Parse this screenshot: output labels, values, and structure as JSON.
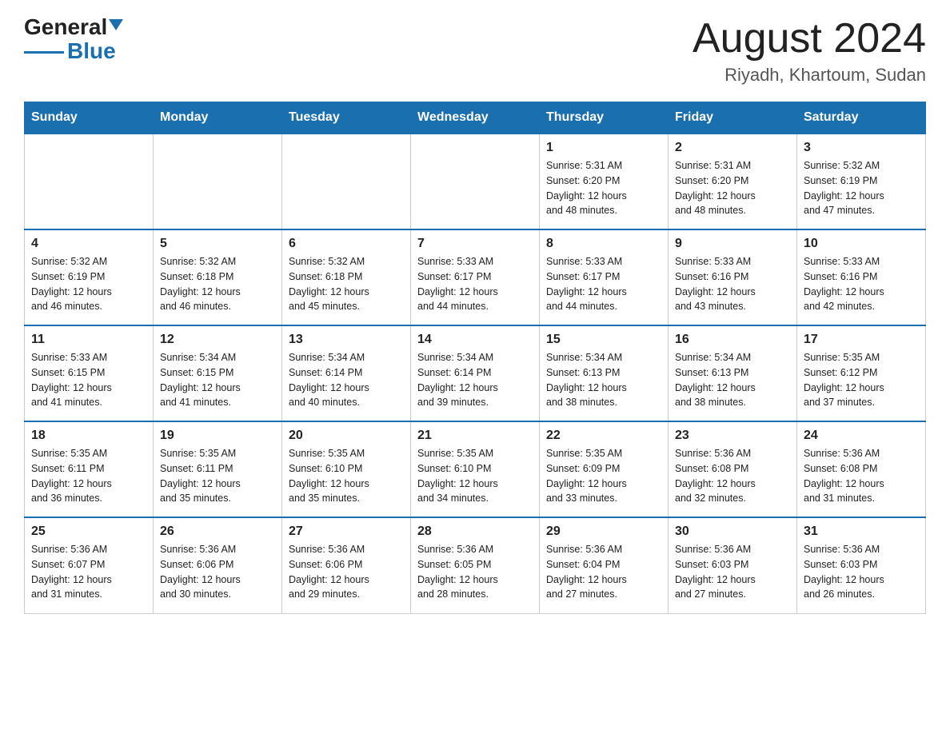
{
  "logo": {
    "general": "General",
    "blue": "Blue"
  },
  "header": {
    "month": "August 2024",
    "location": "Riyadh, Khartoum, Sudan"
  },
  "days_of_week": [
    "Sunday",
    "Monday",
    "Tuesday",
    "Wednesday",
    "Thursday",
    "Friday",
    "Saturday"
  ],
  "weeks": [
    [
      {
        "day": "",
        "info": ""
      },
      {
        "day": "",
        "info": ""
      },
      {
        "day": "",
        "info": ""
      },
      {
        "day": "",
        "info": ""
      },
      {
        "day": "1",
        "info": "Sunrise: 5:31 AM\nSunset: 6:20 PM\nDaylight: 12 hours\nand 48 minutes."
      },
      {
        "day": "2",
        "info": "Sunrise: 5:31 AM\nSunset: 6:20 PM\nDaylight: 12 hours\nand 48 minutes."
      },
      {
        "day": "3",
        "info": "Sunrise: 5:32 AM\nSunset: 6:19 PM\nDaylight: 12 hours\nand 47 minutes."
      }
    ],
    [
      {
        "day": "4",
        "info": "Sunrise: 5:32 AM\nSunset: 6:19 PM\nDaylight: 12 hours\nand 46 minutes."
      },
      {
        "day": "5",
        "info": "Sunrise: 5:32 AM\nSunset: 6:18 PM\nDaylight: 12 hours\nand 46 minutes."
      },
      {
        "day": "6",
        "info": "Sunrise: 5:32 AM\nSunset: 6:18 PM\nDaylight: 12 hours\nand 45 minutes."
      },
      {
        "day": "7",
        "info": "Sunrise: 5:33 AM\nSunset: 6:17 PM\nDaylight: 12 hours\nand 44 minutes."
      },
      {
        "day": "8",
        "info": "Sunrise: 5:33 AM\nSunset: 6:17 PM\nDaylight: 12 hours\nand 44 minutes."
      },
      {
        "day": "9",
        "info": "Sunrise: 5:33 AM\nSunset: 6:16 PM\nDaylight: 12 hours\nand 43 minutes."
      },
      {
        "day": "10",
        "info": "Sunrise: 5:33 AM\nSunset: 6:16 PM\nDaylight: 12 hours\nand 42 minutes."
      }
    ],
    [
      {
        "day": "11",
        "info": "Sunrise: 5:33 AM\nSunset: 6:15 PM\nDaylight: 12 hours\nand 41 minutes."
      },
      {
        "day": "12",
        "info": "Sunrise: 5:34 AM\nSunset: 6:15 PM\nDaylight: 12 hours\nand 41 minutes."
      },
      {
        "day": "13",
        "info": "Sunrise: 5:34 AM\nSunset: 6:14 PM\nDaylight: 12 hours\nand 40 minutes."
      },
      {
        "day": "14",
        "info": "Sunrise: 5:34 AM\nSunset: 6:14 PM\nDaylight: 12 hours\nand 39 minutes."
      },
      {
        "day": "15",
        "info": "Sunrise: 5:34 AM\nSunset: 6:13 PM\nDaylight: 12 hours\nand 38 minutes."
      },
      {
        "day": "16",
        "info": "Sunrise: 5:34 AM\nSunset: 6:13 PM\nDaylight: 12 hours\nand 38 minutes."
      },
      {
        "day": "17",
        "info": "Sunrise: 5:35 AM\nSunset: 6:12 PM\nDaylight: 12 hours\nand 37 minutes."
      }
    ],
    [
      {
        "day": "18",
        "info": "Sunrise: 5:35 AM\nSunset: 6:11 PM\nDaylight: 12 hours\nand 36 minutes."
      },
      {
        "day": "19",
        "info": "Sunrise: 5:35 AM\nSunset: 6:11 PM\nDaylight: 12 hours\nand 35 minutes."
      },
      {
        "day": "20",
        "info": "Sunrise: 5:35 AM\nSunset: 6:10 PM\nDaylight: 12 hours\nand 35 minutes."
      },
      {
        "day": "21",
        "info": "Sunrise: 5:35 AM\nSunset: 6:10 PM\nDaylight: 12 hours\nand 34 minutes."
      },
      {
        "day": "22",
        "info": "Sunrise: 5:35 AM\nSunset: 6:09 PM\nDaylight: 12 hours\nand 33 minutes."
      },
      {
        "day": "23",
        "info": "Sunrise: 5:36 AM\nSunset: 6:08 PM\nDaylight: 12 hours\nand 32 minutes."
      },
      {
        "day": "24",
        "info": "Sunrise: 5:36 AM\nSunset: 6:08 PM\nDaylight: 12 hours\nand 31 minutes."
      }
    ],
    [
      {
        "day": "25",
        "info": "Sunrise: 5:36 AM\nSunset: 6:07 PM\nDaylight: 12 hours\nand 31 minutes."
      },
      {
        "day": "26",
        "info": "Sunrise: 5:36 AM\nSunset: 6:06 PM\nDaylight: 12 hours\nand 30 minutes."
      },
      {
        "day": "27",
        "info": "Sunrise: 5:36 AM\nSunset: 6:06 PM\nDaylight: 12 hours\nand 29 minutes."
      },
      {
        "day": "28",
        "info": "Sunrise: 5:36 AM\nSunset: 6:05 PM\nDaylight: 12 hours\nand 28 minutes."
      },
      {
        "day": "29",
        "info": "Sunrise: 5:36 AM\nSunset: 6:04 PM\nDaylight: 12 hours\nand 27 minutes."
      },
      {
        "day": "30",
        "info": "Sunrise: 5:36 AM\nSunset: 6:03 PM\nDaylight: 12 hours\nand 27 minutes."
      },
      {
        "day": "31",
        "info": "Sunrise: 5:36 AM\nSunset: 6:03 PM\nDaylight: 12 hours\nand 26 minutes."
      }
    ]
  ]
}
